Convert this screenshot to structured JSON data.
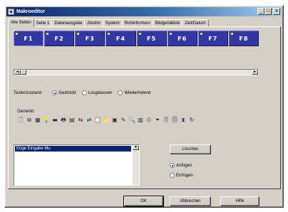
{
  "window": {
    "title": "Makroeditor",
    "min_label": "_",
    "max_label": "□",
    "close_label": "x"
  },
  "tabs": [
    {
      "label": "Alle Seiten"
    },
    {
      "label": "Seite 1"
    },
    {
      "label": "Datenausgabe"
    },
    {
      "label": "Abstim"
    },
    {
      "label": "System"
    },
    {
      "label": "Rohinformerv"
    },
    {
      "label": "Bildgehäkkte"
    },
    {
      "label": "Zeit/Datum"
    }
  ],
  "fkeys": [
    "F1",
    "F2",
    "F3",
    "F4",
    "F5",
    "F6",
    "F7",
    "F8"
  ],
  "scroll": {
    "left": "◄",
    "right": "►",
    "up": "▲",
    "down": "▼"
  },
  "zustand": {
    "label": "Tastenzustand:",
    "options": [
      "Gedrückt",
      "Losgelassen",
      "Wiederholend"
    ],
    "selected": "Gedrückt"
  },
  "befehl": {
    "label": "Gemerkt:",
    "icons": [
      "page-icon",
      "copy-icon",
      "chart-icon",
      "bulb-icon",
      "card-icon",
      "print-icon",
      "grid-icon",
      "arrow-icon",
      "link-icon",
      "clipboard-icon",
      "folder-icon",
      "stamp-icon",
      "pen-icon",
      "search-icon",
      "table-icon",
      "clock-icon",
      "funnel-icon",
      "doc-icon",
      "doc2-icon",
      "hourglass-icon",
      "redo-icon"
    ],
    "glyphs": [
      "🗋",
      "⧉",
      "▦",
      "💡",
      "▬",
      "🖶",
      "▤",
      "⇆",
      "⇄",
      "📋",
      "📁",
      "▣",
      "✎",
      "🔍",
      "▥",
      "⏲",
      "⏷",
      "🗎",
      "🗐",
      "⧗",
      "↻"
    ]
  },
  "list": {
    "selected_item": "Enge Eingabe Mu"
  },
  "buttons": {
    "loeschen": "Löschen",
    "ok": "OK",
    "abbrechen": "Abbrechen",
    "hilfe": "Hilfe"
  },
  "position": {
    "options": [
      "Anfügen",
      "Einfügen"
    ],
    "selected": "Anfügen"
  }
}
